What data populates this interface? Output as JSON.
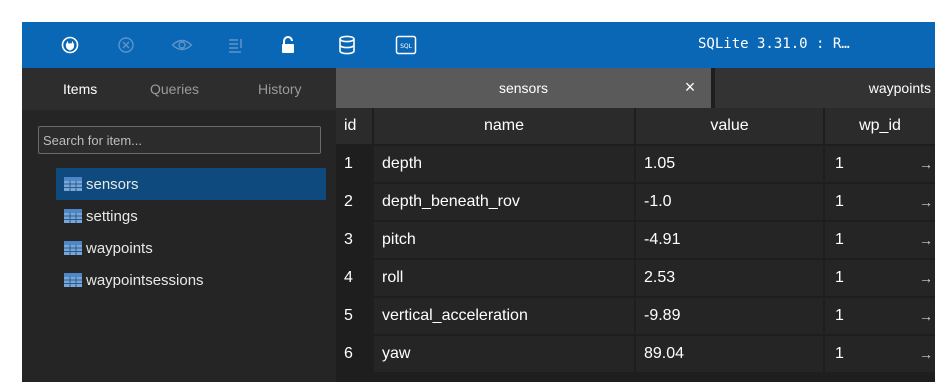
{
  "toolbar": {
    "icons": [
      "connect-icon",
      "disconnect-icon",
      "view-icon",
      "list-icon",
      "lock-icon",
      "database-icon",
      "sql-icon"
    ],
    "title": "SQLite 3.31.0 : R…",
    "sql_label": "SQL"
  },
  "sidebar": {
    "tabs": [
      {
        "label": "Items",
        "active": true
      },
      {
        "label": "Queries",
        "active": false
      },
      {
        "label": "History",
        "active": false
      }
    ],
    "search": {
      "placeholder": "Search for item...",
      "value": ""
    },
    "items": [
      {
        "label": "sensors",
        "selected": true
      },
      {
        "label": "settings",
        "selected": false
      },
      {
        "label": "waypoints",
        "selected": false
      },
      {
        "label": "waypointsessions",
        "selected": false
      }
    ]
  },
  "editor": {
    "tabs": [
      {
        "label": "sensors",
        "active": true,
        "close": "×"
      },
      {
        "label": "waypoints",
        "active": false
      }
    ],
    "table": {
      "columns": [
        "id",
        "name",
        "value",
        "wp_id"
      ],
      "arrow": "→",
      "rows": [
        {
          "id": "1",
          "name": "depth",
          "value": "1.05",
          "wp_id": "1"
        },
        {
          "id": "2",
          "name": "depth_beneath_rov",
          "value": "-1.0",
          "wp_id": "1"
        },
        {
          "id": "3",
          "name": "pitch",
          "value": "-4.91",
          "wp_id": "1"
        },
        {
          "id": "4",
          "name": "roll",
          "value": "2.53",
          "wp_id": "1"
        },
        {
          "id": "5",
          "name": "vertical_acceleration",
          "value": "-9.89",
          "wp_id": "1"
        },
        {
          "id": "6",
          "name": "yaw",
          "value": "89.04",
          "wp_id": "1"
        }
      ]
    }
  },
  "colors": {
    "toolbar": "#0a67b5",
    "selection": "#0e4a7d",
    "background": "#1e1e1e"
  }
}
